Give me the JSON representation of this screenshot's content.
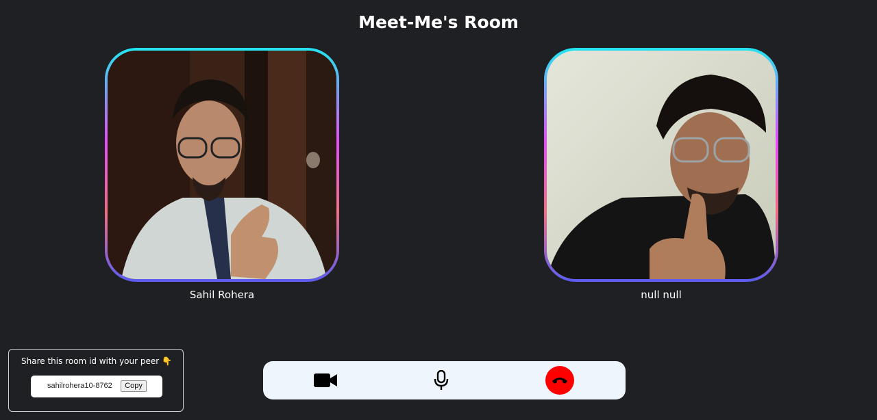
{
  "room": {
    "title": "Meet-Me's Room"
  },
  "participants": [
    {
      "name": "Sahil Rohera"
    },
    {
      "name": "null null"
    }
  ],
  "share": {
    "message": "Share this room id with your peer 👇",
    "room_id": "sahilrohera10-8762",
    "copy_label": "Copy"
  },
  "controls": {
    "camera_icon": "video-camera-icon",
    "mic_icon": "microphone-icon",
    "end_call_icon": "phone-hangup-icon"
  },
  "colors": {
    "background": "#1f2024",
    "controls_bg": "#eef5fc",
    "end_call": "#ff0000",
    "tile_gradient": [
      "#21e6f0",
      "#e24df5",
      "#f06e82",
      "#5b5cf2"
    ]
  }
}
